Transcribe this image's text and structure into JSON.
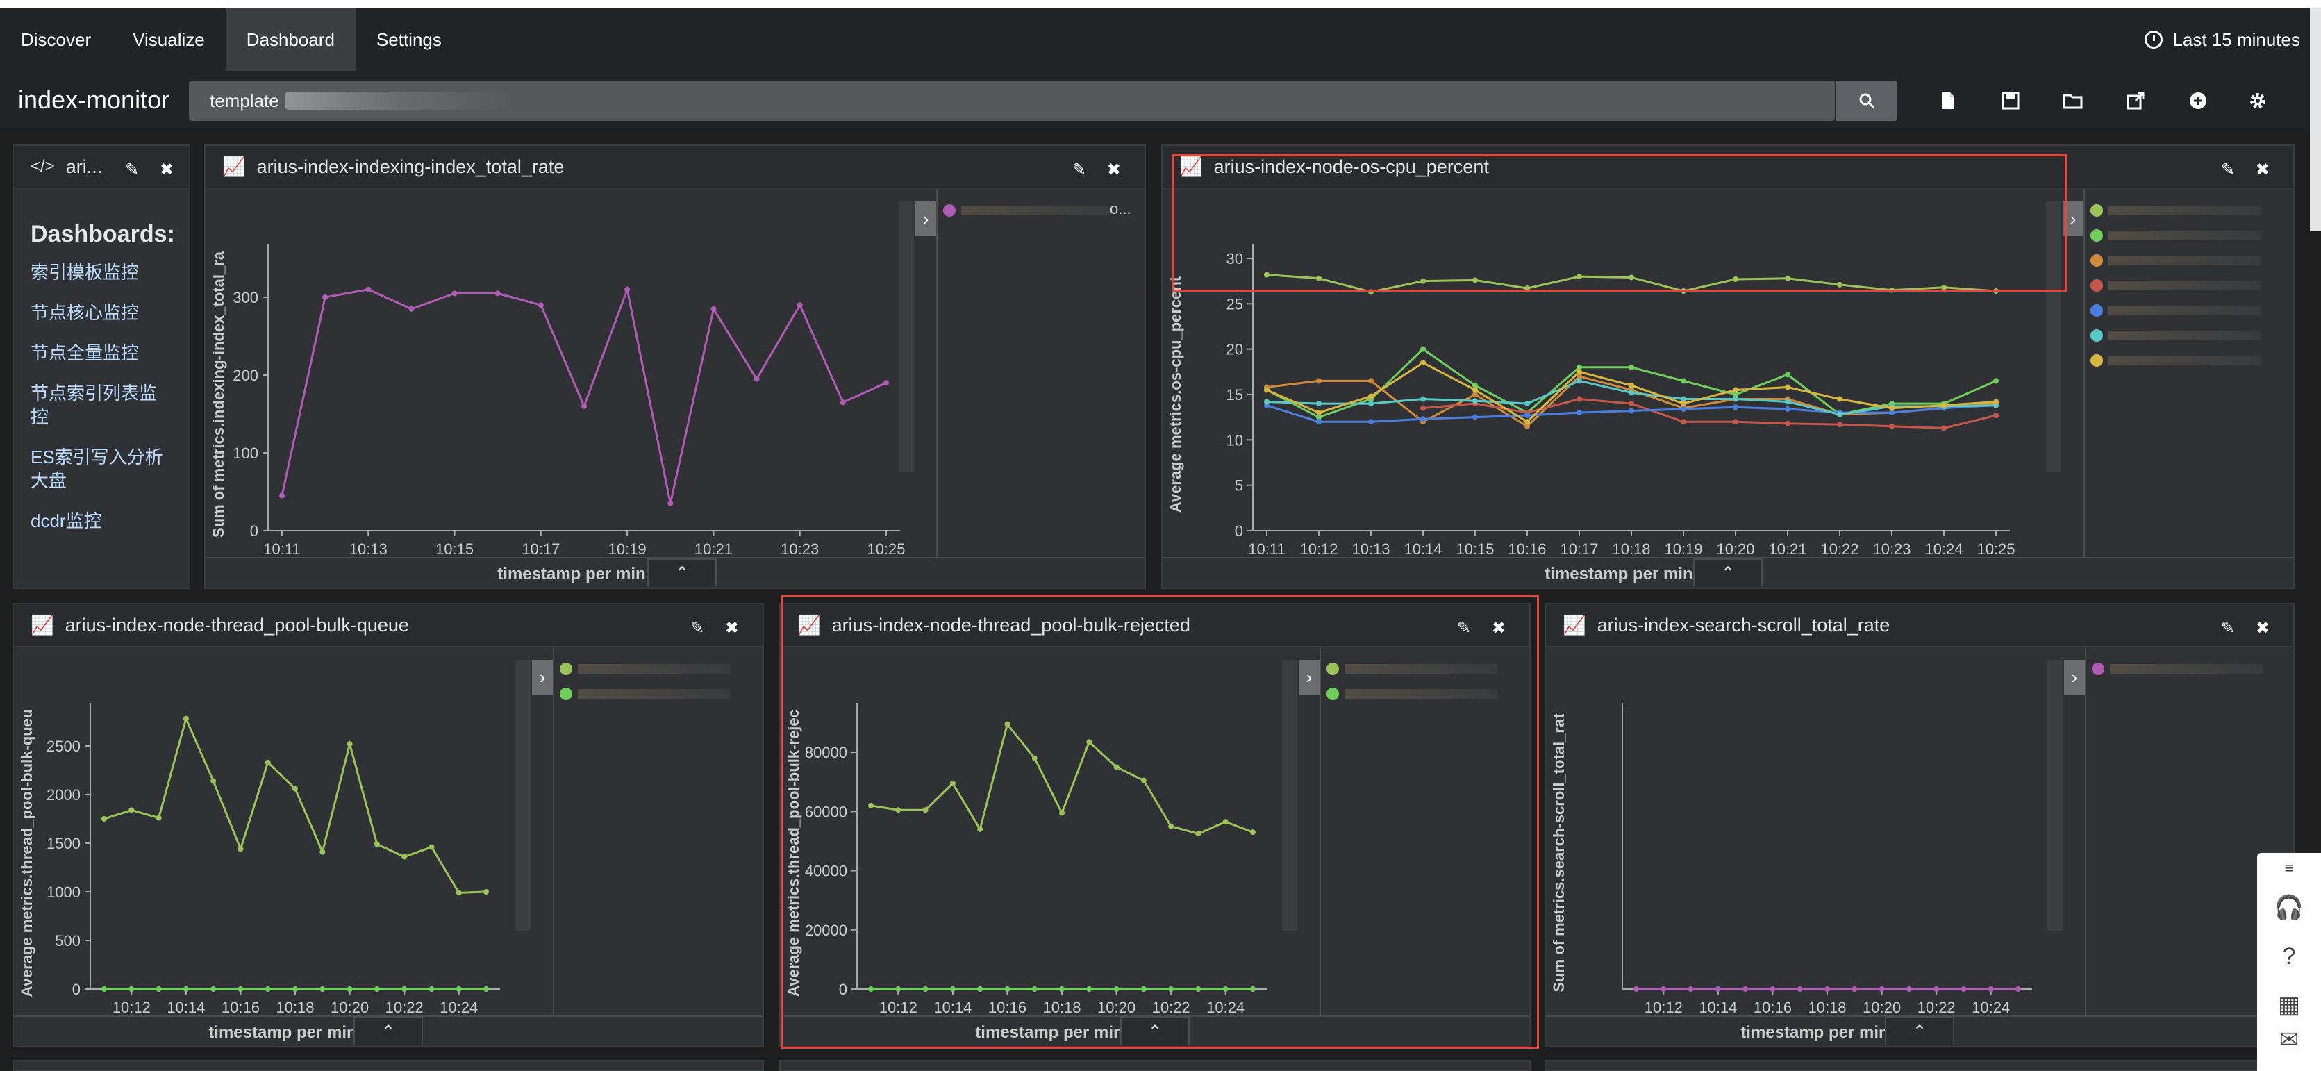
{
  "nav": {
    "tabs": [
      "Discover",
      "Visualize",
      "Dashboard",
      "Settings"
    ],
    "time_label": "Last 15 minutes"
  },
  "toolbar": {
    "dashboard_name": "index-monitor",
    "query_value": "template"
  },
  "markdown_panel": {
    "title": "ari...",
    "heading": "Dashboards:",
    "links": [
      "索引模板监控",
      "节点核心监控",
      "节点全量监控",
      "节点索引列表监\n控",
      "ES索引写入分析\n大盘",
      "dcdr监控"
    ]
  },
  "colors": {
    "purple": "#b05bb5",
    "green": "#9ac35a",
    "bright_green": "#6fcf5d",
    "orange": "#d08a3c",
    "blue": "#4a7fe0",
    "red": "#c6574b",
    "cyan": "#58c9c4",
    "yellow": "#d7b63f"
  },
  "charts": [
    {
      "id": "p1",
      "title": "arius-index-indexing-index_total_rate",
      "xlabel": "timestamp per minute",
      "ylabel": "Sum of metrics.indexing-index_total_ra",
      "xticks": [
        "10:11",
        "10:13",
        "10:15",
        "10:17",
        "10:19",
        "10:21",
        "10:23",
        "10:25"
      ],
      "yticks": [
        "0",
        "100",
        "200",
        "300"
      ],
      "legend_label": "o...",
      "chart_data": {
        "type": "line",
        "x": [
          "10:11",
          "10:12",
          "10:13",
          "10:14",
          "10:15",
          "10:16",
          "10:17",
          "10:18",
          "10:19",
          "10:20",
          "10:21",
          "10:22",
          "10:23",
          "10:24",
          "10:25"
        ],
        "ylim": [
          0,
          350
        ],
        "series": [
          {
            "color": "#b05bb5",
            "values": [
              45,
              300,
              310,
              285,
              305,
              305,
              290,
              160,
              310,
              35,
              285,
              195,
              290,
              165,
              190
            ]
          }
        ]
      }
    },
    {
      "id": "p2",
      "title": "arius-index-node-os-cpu_percent",
      "xlabel": "timestamp per minute",
      "ylabel": "Average metrics.os-cpu_percent",
      "xticks": [
        "10:11",
        "10:12",
        "10:13",
        "10:14",
        "10:15",
        "10:16",
        "10:17",
        "10:18",
        "10:19",
        "10:20",
        "10:21",
        "10:22",
        "10:23",
        "10:24",
        "10:25"
      ],
      "yticks": [
        "0",
        "5",
        "10",
        "15",
        "20",
        "25",
        "30"
      ],
      "chart_data": {
        "type": "line",
        "x": [
          "10:11",
          "10:12",
          "10:13",
          "10:14",
          "10:15",
          "10:16",
          "10:17",
          "10:18",
          "10:19",
          "10:20",
          "10:21",
          "10:22",
          "10:23",
          "10:24",
          "10:25"
        ],
        "ylim": [
          0,
          30
        ],
        "series": [
          {
            "color": "#9ac35a",
            "values": [
              28.2,
              27.8,
              26.3,
              27.5,
              27.6,
              26.7,
              28,
              27.9,
              26.4,
              27.7,
              27.8,
              27.1,
              26.5,
              26.8,
              26.4
            ]
          },
          {
            "color": "#6fcf5d",
            "values": [
              15.5,
              12.5,
              14.5,
              20,
              16,
              13,
              18,
              18,
              16.5,
              15,
              17.2,
              12.8,
              14,
              14,
              16.5
            ]
          },
          {
            "color": "#d08a3c",
            "values": [
              15.8,
              16.5,
              16.5,
              12,
              15,
              11.5,
              17,
              15.5,
              13.5,
              14.5,
              14.5,
              12.8,
              13,
              13.5,
              14
            ]
          },
          {
            "color": "#c6574b",
            "values": [
              null,
              null,
              null,
              13.5,
              14,
              13,
              14.5,
              14,
              12,
              12,
              11.8,
              11.7,
              11.5,
              11.3,
              12.7
            ]
          },
          {
            "color": "#4a7fe0",
            "values": [
              13.8,
              12,
              12,
              12.3,
              12.5,
              12.7,
              13,
              13.2,
              13.4,
              13.6,
              13.4,
              13,
              13,
              13.5,
              13.8
            ]
          },
          {
            "color": "#58c9c4",
            "values": [
              14.2,
              14,
              14,
              14.5,
              14.3,
              14,
              16.5,
              15.2,
              14.5,
              14.5,
              14.2,
              12.8,
              13.7,
              13.7,
              13.8
            ]
          },
          {
            "color": "#d7b63f",
            "values": [
              15.5,
              13,
              14.8,
              18.5,
              15.5,
              12,
              17.5,
              16,
              14,
              15.5,
              15.8,
              14.5,
              13.5,
              13.8,
              14.2
            ]
          }
        ]
      }
    },
    {
      "id": "p3",
      "title": "arius-index-node-thread_pool-bulk-queue",
      "xlabel": "timestamp per minute",
      "ylabel": "Average metrics.thread_pool-bulk-queu",
      "xticks": [
        "10:12",
        "10:14",
        "10:16",
        "10:18",
        "10:20",
        "10:22",
        "10:24"
      ],
      "yticks": [
        "0",
        "500",
        "1000",
        "1500",
        "2000",
        "2500"
      ],
      "chart_data": {
        "type": "line",
        "x": [
          "10:11",
          "10:12",
          "10:13",
          "10:14",
          "10:15",
          "10:16",
          "10:17",
          "10:18",
          "10:19",
          "10:20",
          "10:21",
          "10:22",
          "10:23",
          "10:24",
          "10:25"
        ],
        "ylim": [
          0,
          2800
        ],
        "series": [
          {
            "color": "#9ac35a",
            "values": [
              1750,
              1840,
              1760,
              2780,
              2140,
              1440,
              2330,
              2060,
              1410,
              2520,
              1490,
              1360,
              1460,
              990,
              1000
            ]
          },
          {
            "color": "#6fcf5d",
            "values": [
              0,
              0,
              0,
              0,
              0,
              0,
              0,
              0,
              0,
              0,
              0,
              0,
              0,
              0,
              0
            ]
          }
        ]
      }
    },
    {
      "id": "p4",
      "title": "arius-index-node-thread_pool-bulk-rejected",
      "xlabel": "timestamp per minute",
      "ylabel": "Average metrics.thread_pool-bulk-rejec",
      "xticks": [
        "10:12",
        "10:14",
        "10:16",
        "10:18",
        "10:20",
        "10:22",
        "10:24"
      ],
      "yticks": [
        "0",
        "20000",
        "40000",
        "60000",
        "80000"
      ],
      "chart_data": {
        "type": "line",
        "x": [
          "10:11",
          "10:12",
          "10:13",
          "10:14",
          "10:15",
          "10:16",
          "10:17",
          "10:18",
          "10:19",
          "10:20",
          "10:21",
          "10:22",
          "10:23",
          "10:24",
          "10:25"
        ],
        "ylim": [
          0,
          92000
        ],
        "series": [
          {
            "color": "#9ac35a",
            "values": [
              62000,
              60500,
              60500,
              69500,
              54000,
              89500,
              78000,
              59500,
              83500,
              75000,
              70500,
              55000,
              52500,
              56500,
              53000
            ]
          },
          {
            "color": "#6fcf5d",
            "values": [
              0,
              0,
              0,
              0,
              0,
              0,
              0,
              0,
              0,
              0,
              0,
              0,
              0,
              0,
              0
            ]
          }
        ]
      }
    },
    {
      "id": "p5",
      "title": "arius-index-search-scroll_total_rate",
      "xlabel": "timestamp per minute",
      "ylabel": "Sum of metrics.search-scroll_total_rat",
      "xticks": [
        "10:12",
        "10:14",
        "10:16",
        "10:18",
        "10:20",
        "10:22",
        "10:24"
      ],
      "yticks": [],
      "chart_data": {
        "type": "line",
        "x": [
          "10:11",
          "10:12",
          "10:13",
          "10:14",
          "10:15",
          "10:16",
          "10:17",
          "10:18",
          "10:19",
          "10:20",
          "10:21",
          "10:22",
          "10:23",
          "10:24",
          "10:25"
        ],
        "ylim": [
          0,
          1
        ],
        "series": [
          {
            "color": "#b05bb5",
            "values": [
              0,
              0,
              0,
              0,
              0,
              0,
              0,
              0,
              0,
              0,
              0,
              0,
              0,
              0,
              0
            ]
          }
        ]
      }
    }
  ]
}
